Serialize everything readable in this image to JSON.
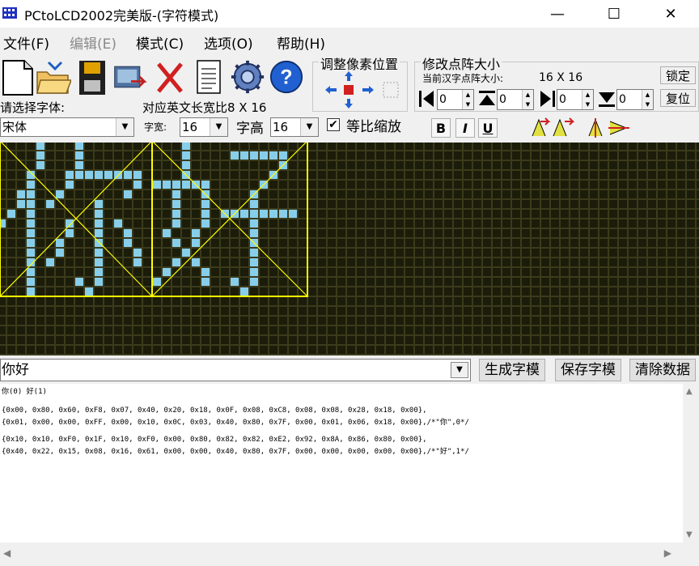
{
  "window": {
    "title": "PCtoLCD2002完美版-(字符模式)",
    "controls": {
      "minimize": "—",
      "maximize": "☐",
      "close": "✕"
    }
  },
  "menu": [
    {
      "label": "文件(F)",
      "enabled": true
    },
    {
      "label": "编辑(E)",
      "enabled": false
    },
    {
      "label": "模式(C)",
      "enabled": true
    },
    {
      "label": "选项(O)",
      "enabled": true
    },
    {
      "label": "帮助(H)",
      "enabled": true
    }
  ],
  "toolbar": {
    "icons": [
      "new-file-icon",
      "open-folder-icon",
      "save-disk-icon",
      "export-icon",
      "delete-icon",
      "notepad-icon",
      "settings-gear-icon",
      "help-icon"
    ],
    "pixel_position_title": "调整像素位置",
    "dot_matrix_title": "修改点阵大小",
    "current_size_label": "当前汉字点阵大小:",
    "current_size_value": "16  X  16",
    "lock_button": "锁定",
    "reset_button": "复位",
    "spin_values": [
      "0",
      "0",
      "0",
      "0"
    ],
    "font_label": "请选择字体:",
    "font_value": "宋体",
    "ratio_label": "对应英文长宽比8 X 16",
    "width_label": "字宽:",
    "width_value": "16",
    "height_label": "字高",
    "height_value": "16",
    "proportional_label": "等比缩放",
    "proportional_checked": true,
    "bold": "B",
    "italic": "I",
    "underline": "U"
  },
  "colors": {
    "grid_bg": "#3b3b1c",
    "pixel_on": "#87ceeb",
    "guide": "#ffff00"
  },
  "input": {
    "text_value": "你好",
    "generate_button": "生成字模",
    "save_button": "保存字模",
    "clear_button": "清除数据"
  },
  "output": {
    "header": "你(0) 好(1)",
    "lines": [
      "{0x00, 0x80, 0x60, 0xF8, 0x07, 0x40, 0x20, 0x18, 0x0F, 0x08, 0xC8, 0x08, 0x08, 0x28, 0x18, 0x00},",
      "{0x01, 0x00, 0x00, 0xFF, 0x00, 0x10, 0x0C, 0x03, 0x40, 0x80, 0x7F, 0x00, 0x01, 0x06, 0x18, 0x00},/*\"你\",0*/",
      "",
      "{0x10, 0x10, 0xF0, 0x1F, 0x10, 0xF0, 0x00, 0x80, 0x82, 0x82, 0xE2, 0x92, 0x8A, 0x86, 0x80, 0x00},",
      "{0x40, 0x22, 0x15, 0x08, 0x16, 0x61, 0x00, 0x00, 0x40, 0x80, 0x7F, 0x00, 0x00, 0x00, 0x00, 0x00},/*\"好\",1*/"
    ]
  }
}
